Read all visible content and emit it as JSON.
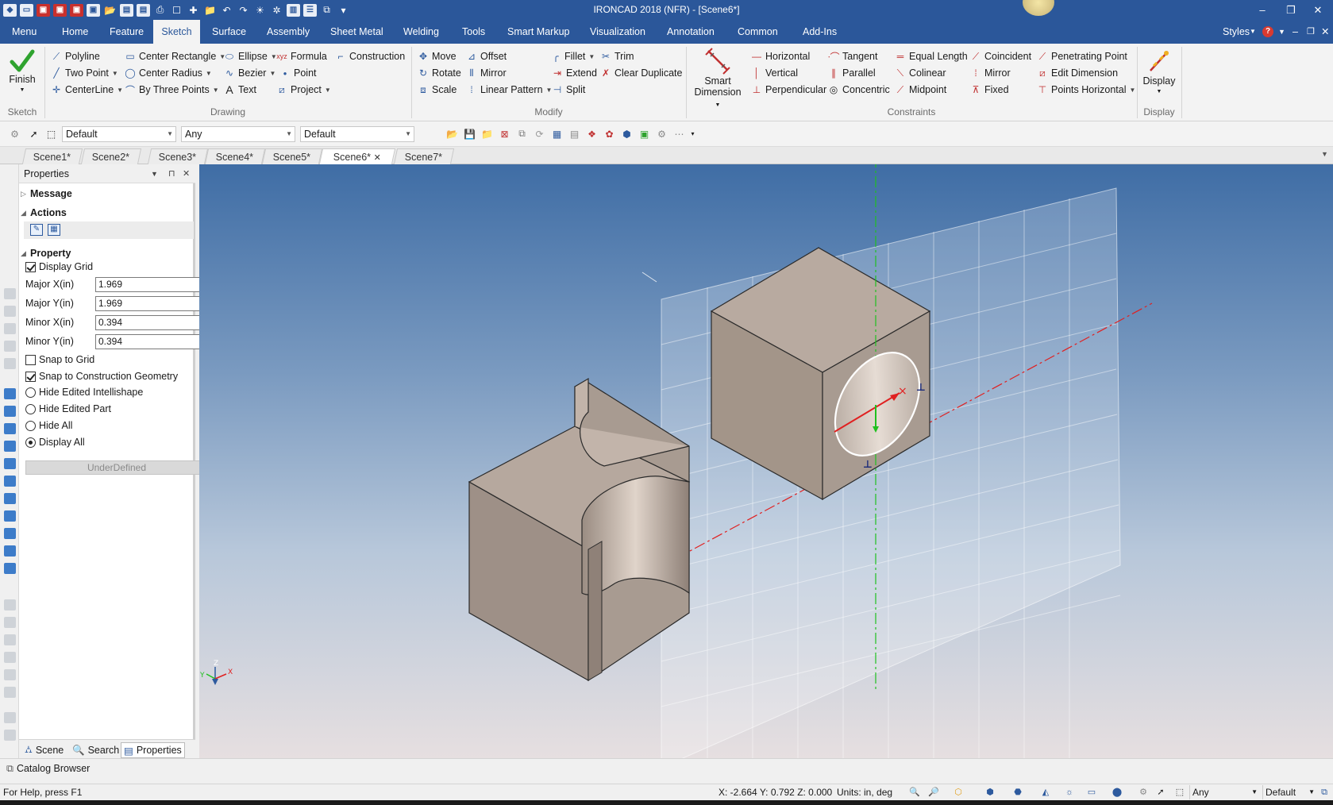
{
  "window": {
    "title": "IRONCAD 2018 (NFR) - [Scene6*]",
    "minimize": "–",
    "restore": "❐",
    "close": "✕"
  },
  "ribbon_tabs": [
    "Menu",
    "Home",
    "Feature",
    "Sketch",
    "Surface",
    "Assembly",
    "Sheet Metal",
    "Welding",
    "Tools",
    "Smart Markup",
    "Visualization",
    "Annotation",
    "Common",
    "Add-Ins"
  ],
  "ribbon_active_tab": "Sketch",
  "ribbon_right": {
    "styles": "Styles",
    "help": "?"
  },
  "groups": {
    "sketch": {
      "label": "Sketch",
      "finish": "Finish"
    },
    "drawing": {
      "label": "Drawing",
      "items": [
        "Polyline",
        "Center Rectangle",
        "Ellipse",
        "Formula",
        "Construction",
        "Two Point",
        "Center Radius",
        "Bezier",
        "Point",
        "CenterLine",
        "By Three Points",
        "Text",
        "Project"
      ]
    },
    "modify": {
      "label": "Modify",
      "items": [
        "Move",
        "Offset",
        "Fillet",
        "Trim",
        "Rotate",
        "Mirror",
        "Extend",
        "Clear Duplicate",
        "Scale",
        "Linear Pattern",
        "Split"
      ]
    },
    "constraints": {
      "label": "Constraints",
      "smart_dimension": [
        "Smart",
        "Dimension"
      ],
      "items": [
        "Horizontal",
        "Tangent",
        "Equal Length",
        "Coincident",
        "Penetrating Point",
        "Vertical",
        "Parallel",
        "Colinear",
        "Mirror",
        "Edit Dimension",
        "Perpendicular",
        "Concentric",
        "Midpoint",
        "Fixed",
        "Points Horizontal"
      ]
    },
    "display": {
      "label": "Display",
      "button": "Display"
    }
  },
  "toolbar": {
    "combo1": "Default",
    "combo2": "Any",
    "combo3": "Default"
  },
  "scene_tabs": [
    "Scene1*",
    "Scene2*",
    "Scene3*",
    "Scene4*",
    "Scene5*",
    "Scene6*",
    "Scene7*"
  ],
  "active_scene": "Scene6*",
  "properties": {
    "title": "Properties",
    "sections": {
      "message": "Message",
      "actions": "Actions",
      "property": "Property"
    },
    "display_grid": {
      "label": "Display Grid",
      "checked": true
    },
    "major_x": {
      "label": "Major X(in)",
      "value": "1.969"
    },
    "major_y": {
      "label": "Major Y(in)",
      "value": "1.969"
    },
    "minor_x": {
      "label": "Minor X(in)",
      "value": "0.394"
    },
    "minor_y": {
      "label": "Minor Y(in)",
      "value": "0.394"
    },
    "snap_grid": {
      "label": "Snap to Grid",
      "checked": false
    },
    "snap_construction": {
      "label": "Snap to Construction Geometry",
      "checked": true
    },
    "radio_options": [
      "Hide Edited Intellishape",
      "Hide Edited Part",
      "Hide All",
      "Display All"
    ],
    "radio_selected": "Display All",
    "status_button": "UnderDefined",
    "bottom_tabs": [
      "Scene",
      "Search",
      "Properties"
    ]
  },
  "triad": {
    "z": "Z",
    "y": "Y",
    "x": "X"
  },
  "catalog": "Catalog Browser",
  "status": {
    "help": "For Help, press F1",
    "coords": "X: -2.664 Y: 0.792 Z: 0.000",
    "units": "Units: in, deg",
    "combo_any": "Any",
    "combo_default": "Default"
  },
  "colors": {
    "title_bar": "#2b579a",
    "viewport_top": "#3f6da5",
    "part_face": "#a99b90",
    "sketch_ellipse": "#ffffff",
    "x_axis": "#e02020",
    "y_axis": "#20c020"
  }
}
